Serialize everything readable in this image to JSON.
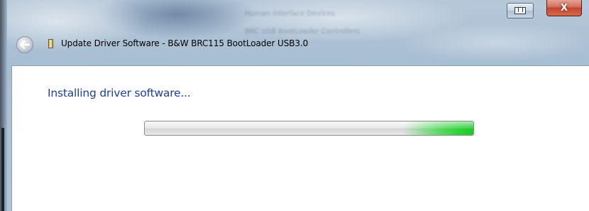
{
  "window": {
    "title": "Update Driver Software - B&W BRC115 BootLoader USB3.0",
    "close_glyph": "X",
    "background_blur_lines": [
      "Human Interface Devices",
      "BRC USB BootLoader Controllers"
    ]
  },
  "main": {
    "heading": "Installing driver software..."
  },
  "progress": {
    "mode": "indeterminate",
    "color": "#2fd238"
  },
  "colors": {
    "heading": "#1e3f9c",
    "close_button": "#c14631"
  },
  "icons": {
    "back": "back-arrow-icon",
    "title": "driver-icon",
    "restore": "restore-icon",
    "close": "close-icon"
  }
}
